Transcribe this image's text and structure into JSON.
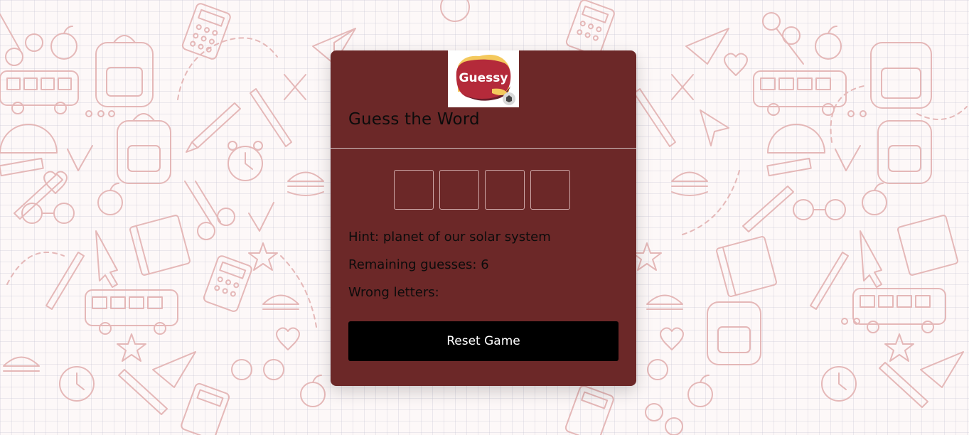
{
  "logo": {
    "text": "Guessy",
    "icon": "guessy-logo"
  },
  "title": "Guess the Word",
  "word_slots": [
    "",
    "",
    "",
    ""
  ],
  "hint": {
    "label": "Hint:",
    "text": "planet of our solar system"
  },
  "remaining": {
    "label": "Remaining guesses:",
    "value": "6"
  },
  "wrong": {
    "label": "Wrong letters:",
    "value": ""
  },
  "reset_label": "Reset Game",
  "colors": {
    "card": "#6c2828",
    "button": "#000000",
    "doodle": "#e2b5b5"
  }
}
